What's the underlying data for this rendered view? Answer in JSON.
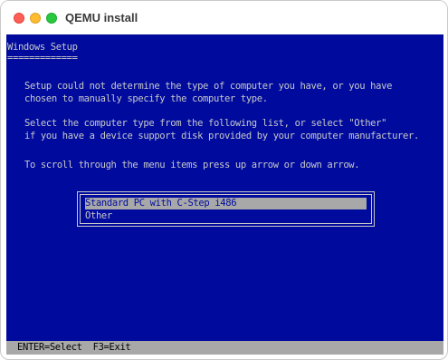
{
  "window": {
    "title": "QEMU install"
  },
  "setup": {
    "heading": "Windows Setup",
    "underline": "=============",
    "paragraph1": [
      "Setup could not determine the type of computer you have, or you have",
      "chosen to manually specify the computer type."
    ],
    "paragraph2": [
      "Select the computer type from the following list, or select \"Other\"",
      "if you have a device support disk provided by your computer manufacturer."
    ],
    "paragraph3": "To scroll through the menu items press up arrow or down arrow.",
    "menu": {
      "items": [
        "Standard PC with C-Step i486",
        "Other"
      ],
      "selected_index": 0
    },
    "status": "ENTER=Select  F3=Exit"
  },
  "colors": {
    "screen_bg": "#000b9e",
    "text": "#c8c8c8",
    "highlight": "#a8a8a8"
  }
}
